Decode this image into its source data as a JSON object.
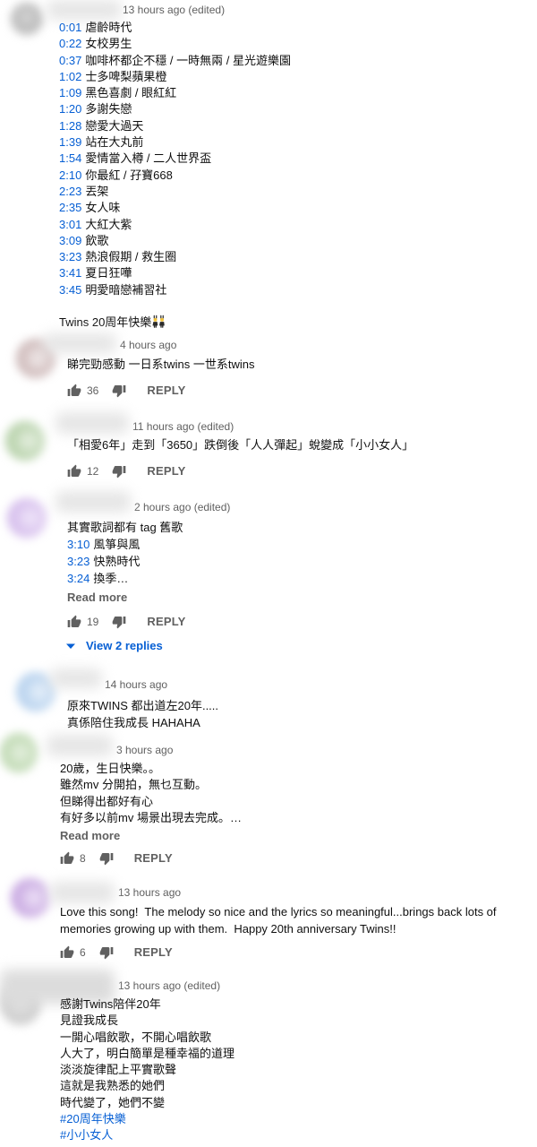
{
  "colors": {
    "link": "#065fd4",
    "meta": "#606060",
    "text": "#0f0f0f"
  },
  "labels": {
    "reply": "REPLY",
    "read_more": "Read more"
  },
  "comments": [
    {
      "time": "13 hours ago (edited)",
      "timestamps": [
        {
          "t": "0:01",
          "title": "虐齡時代"
        },
        {
          "t": "0:22",
          "title": "女校男生"
        },
        {
          "t": "0:37",
          "title": "咖啡杯都企不穩 / 一時無兩 / 星光遊樂園"
        },
        {
          "t": "1:02",
          "title": "士多啤梨蘋果橙"
        },
        {
          "t": "1:09",
          "title": "黑色喜劇 / 眼紅紅"
        },
        {
          "t": "1:20",
          "title": "多謝失戀"
        },
        {
          "t": "1:28",
          "title": "戀愛大過天"
        },
        {
          "t": "1:39",
          "title": "站在大丸前"
        },
        {
          "t": "1:54",
          "title": "愛情當入樽 / 二人世界盃"
        },
        {
          "t": "2:10",
          "title": "你最紅 / 孖寶668"
        },
        {
          "t": "2:23",
          "title": "丟架"
        },
        {
          "t": "2:35",
          "title": "女人味"
        },
        {
          "t": "3:01",
          "title": "大紅大紫"
        },
        {
          "t": "3:09",
          "title": "飲歌"
        },
        {
          "t": "3:23",
          "title": "熱浪假期 / 救生圈"
        },
        {
          "t": "3:41",
          "title": "夏日狂嘩"
        },
        {
          "t": "3:45",
          "title": "明愛暗戀補習社"
        }
      ],
      "closing_line": "Twins 20周年快樂",
      "closing_emoji_icon": "dancers-emoji-icon"
    },
    {
      "time": "4 hours ago",
      "lines": [
        "睇完勁感動 一日系twins 一世系twins"
      ],
      "likes": "36"
    },
    {
      "time": "11 hours ago (edited)",
      "lines": [
        "「相愛6年」走到「3650」跌倒後「人人彈起」蛻變成「小小女人」"
      ],
      "likes": "12"
    },
    {
      "time": "2 hours ago (edited)",
      "lines": [
        {
          "text": "其實歌詞都有 tag 舊歌"
        },
        {
          "t": "3:10",
          "text": "風箏與風"
        },
        {
          "t": "3:23",
          "text": "快熟時代"
        },
        {
          "t": "3:24",
          "text": "換季…"
        }
      ],
      "likes": "19",
      "view_replies": "View 2 replies"
    },
    {
      "time": "14 hours ago",
      "lines": [
        "原來TWINS 都出道左20年.....",
        "真係陪住我成長 HAHAHA"
      ]
    },
    {
      "time": "3 hours ago",
      "lines": [
        "20歲，生日快樂。。",
        "雖然mv 分開拍，無乜互動。",
        "但睇得出都好有心",
        "有好多以前mv 場景出現去完成。…"
      ],
      "likes": "8"
    },
    {
      "time": "13 hours ago",
      "lines": [
        "Love this song!  The melody so nice and the lyrics so meaningful...brings back lots of",
        "memories growing up with them.  Happy 20th anniversary Twins!!"
      ],
      "likes": "6"
    },
    {
      "time": "13 hours ago (edited)",
      "lines": [
        "感謝Twins陪伴20年",
        "見證我成長",
        "一開心唱飲歌，不開心唱飲歌",
        "人大了，明白簡單是種幸福的道理",
        "淡淡旋律配上平實歌聲",
        "這就是我熟悉的她們",
        "時代變了，她們不變"
      ],
      "hashtags": [
        "#20周年快樂",
        "#小小女人"
      ]
    }
  ]
}
